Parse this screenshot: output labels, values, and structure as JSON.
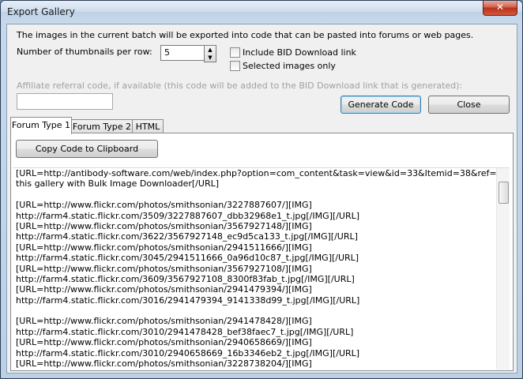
{
  "window": {
    "title": "Export Gallery",
    "close_glyph": "✕"
  },
  "description": "The images in the current batch will be exported into code that can be pasted into forums or web pages.",
  "thumbnails": {
    "label": "Number of thumbnails per row:",
    "value": "5"
  },
  "checkboxes": {
    "include_bid": "Include BID Download link",
    "selected_only": "Selected images only"
  },
  "affiliate": {
    "label": "Affiliate referral code, if available (this code will be added to the BID Download link that is generated):",
    "value": ""
  },
  "buttons": {
    "generate": "Generate Code",
    "close": "Close",
    "copy": "Copy Code to Clipboard"
  },
  "tabs": [
    "Forum Type 1",
    "Forum Type 2",
    "HTML"
  ],
  "code_lines": [
    "[URL=http://antibody-software.com/web/index.php?option=com_content&task=view&id=33&Itemid=38&ref=BID]Download",
    "this gallery with Bulk Image Downloader[/URL]",
    "",
    "[URL=http://www.flickr.com/photos/smithsonian/3227887607/][IMG]",
    "http://farm4.static.flickr.com/3509/3227887607_dbb32968e1_t.jpg[/IMG][/URL]",
    "[URL=http://www.flickr.com/photos/smithsonian/3567927148/][IMG]",
    "http://farm4.static.flickr.com/3622/3567927148_ec9d5ca133_t.jpg[/IMG][/URL]",
    "[URL=http://www.flickr.com/photos/smithsonian/2941511666/][IMG]",
    "http://farm4.static.flickr.com/3045/2941511666_0a96d10c87_t.jpg[/IMG][/URL]",
    "[URL=http://www.flickr.com/photos/smithsonian/3567927108/][IMG]",
    "http://farm4.static.flickr.com/3609/3567927108_8300f83fab_t.jpg[/IMG][/URL]",
    "[URL=http://www.flickr.com/photos/smithsonian/2941479394/][IMG]",
    "http://farm4.static.flickr.com/3016/2941479394_9141338d99_t.jpg[/IMG][/URL]",
    "",
    "[URL=http://www.flickr.com/photos/smithsonian/2941478428/][IMG]",
    "http://farm4.static.flickr.com/3010/2941478428_bef38faec7_t.jpg[/IMG][/URL]",
    "[URL=http://www.flickr.com/photos/smithsonian/2940658669/][IMG]",
    "http://farm4.static.flickr.com/3010/2940658669_16b3346eb2_t.jpg[/IMG][/URL]",
    "[URL=http://www.flickr.com/photos/smithsonian/3228738204/][IMG]"
  ]
}
